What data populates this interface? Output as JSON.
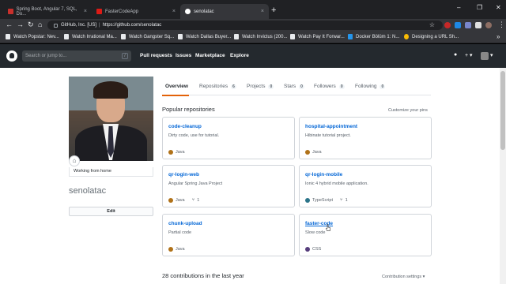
{
  "browser": {
    "tabs": [
      {
        "title": "Spring Boot, Angular 7, SQL, Do...",
        "favicon_color": "#c9302c",
        "active": false
      },
      {
        "title": "FasterCodeApp",
        "favicon_color": "#dd1b16",
        "active": false
      },
      {
        "title": "senolatac",
        "favicon_color": "#ffffff",
        "active": true
      }
    ],
    "new_tab": "+",
    "window_controls": [
      "–",
      "❐",
      "✕"
    ],
    "address": {
      "site": "GitHub, Inc. [US]",
      "separator": "|",
      "url": "https://github.com/senolatac"
    },
    "bookmarks": [
      "Watch Popstar: Nev...",
      "Watch Irrational Ma...",
      "Watch Gangster Sq...",
      "Watch Dallas Buyer...",
      "Watch Invictus (200...",
      "Watch Pay It Forwar...",
      "Docker Bölüm 1: N...",
      "Designing a URL Sh..."
    ],
    "bookmarks_more": "»"
  },
  "github": {
    "search_placeholder": "Search or jump to...",
    "search_key": "/",
    "nav": [
      "Pull requests",
      "Issues",
      "Marketplace",
      "Explore"
    ],
    "icons": {
      "bell": "🔔",
      "plus": "+ ▾",
      "avatar_caret": "▾"
    }
  },
  "profile": {
    "status": "Working from home",
    "status_emoji": "⌂",
    "username": "senolatac",
    "edit_label": "Edit",
    "tabs": [
      {
        "label": "Overview",
        "count": null
      },
      {
        "label": "Repositories",
        "count": "6"
      },
      {
        "label": "Projects",
        "count": "0"
      },
      {
        "label": "Stars",
        "count": "0"
      },
      {
        "label": "Followers",
        "count": "0"
      },
      {
        "label": "Following",
        "count": "0"
      }
    ],
    "popular_title": "Popular repositories",
    "customize_label": "Customize your pins",
    "repos": [
      {
        "name": "code-cleanup",
        "desc": "Dirty code, use for tutorial.",
        "lang": "Java",
        "lang_color": "#b07219",
        "forks": ""
      },
      {
        "name": "hospital-appointment",
        "desc": "Hibinate tutorial project.",
        "lang": "Java",
        "lang_color": "#b07219",
        "forks": ""
      },
      {
        "name": "qr-login-web",
        "desc": "Angular Spring Java Project",
        "lang": "Java",
        "lang_color": "#b07219",
        "forks": "1"
      },
      {
        "name": "qr-login-mobile",
        "desc": "Ionic 4 hybrid mobile application.",
        "lang": "TypeScript",
        "lang_color": "#2b7489",
        "forks": "1"
      },
      {
        "name": "chunk-upload",
        "desc": "Partial code",
        "lang": "Java",
        "lang_color": "#b07219",
        "forks": ""
      },
      {
        "name": "faster-code",
        "desc": "Slow code",
        "lang": "CSS",
        "lang_color": "#563d7c",
        "forks": ""
      }
    ],
    "contrib_title": "28 contributions in the last year",
    "contrib_settings": "Contribution settings ▾"
  }
}
